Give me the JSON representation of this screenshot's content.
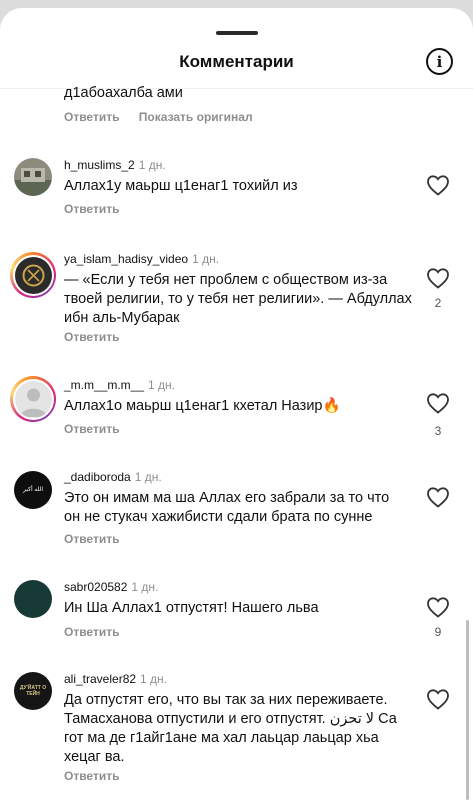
{
  "header": {
    "title": "Комментарии",
    "info_icon": "info-circle-icon"
  },
  "top_partial": {
    "text": "д1абоахалба ами",
    "reply_label": "Ответить",
    "show_original_label": "Показать оригинал"
  },
  "comments": [
    {
      "username": "h_muslims_2",
      "time": "1 дн.",
      "text": "Аллах1у маьрш ц1енаг1 тохийл из",
      "reply_label": "Ответить",
      "likes": ""
    },
    {
      "username": "ya_islam_hadisy_video",
      "time": "1 дн.",
      "text": "— «Если у тебя нет проблем с обществом из-за твоей религии, то у тебя нет религии». — Абдуллах ибн аль-Мубарак",
      "reply_label": "Ответить",
      "likes": "2"
    },
    {
      "username": "_m.m__m.m__",
      "time": "1 дн.",
      "text": "Аллах1о маьрш ц1енаг1 кхетал Назир🔥",
      "reply_label": "Ответить",
      "likes": "3"
    },
    {
      "username": "_dadiboroda",
      "time": "1 дн.",
      "text": "Это он имам ма ша Аллах его забрали за то что он не стукач хажибисти сдали брата по сунне",
      "reply_label": "Ответить",
      "likes": "",
      "avatar_text": "الله أكبر"
    },
    {
      "username": "sabr020582",
      "time": "1 дн.",
      "text": "Ин Ша Аллах1 отпустят! Нашего льва",
      "reply_label": "Ответить",
      "likes": "9"
    },
    {
      "username": "ali_traveler82",
      "time": "1 дн.",
      "text": "Да отпустят его, что вы так за них переживаете. Тамасханова отпустили и его отпустят. لا تحزن Са гот ма де г1айг1ане ма хал лаьцар лаьцар хьа хецаг ва.",
      "reply_label": "Ответить",
      "likes": "",
      "avatar_text": "ДУ'ЙАТТ О ТЕЙН"
    }
  ],
  "colors": {
    "accent_ring": "#dd2a7b",
    "muted": "#8e8e8e",
    "text": "#111111"
  }
}
